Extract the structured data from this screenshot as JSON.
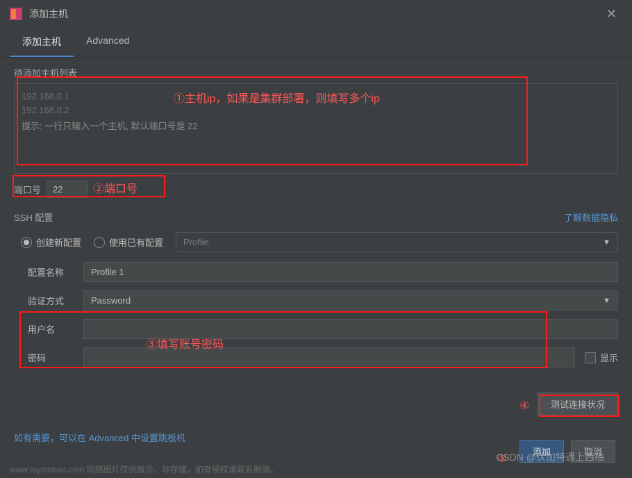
{
  "window": {
    "title": "添加主机"
  },
  "tabs": {
    "t1": "添加主机",
    "t2": "Advanced"
  },
  "hostlist": {
    "label": "待添加主机列表",
    "ip1": "192.168.0.1",
    "ip2": "192.168.0.2",
    "hint": "提示: 一行只输入一个主机, 默认端口号是 22"
  },
  "port": {
    "label": "端口号",
    "value": "22"
  },
  "ssh": {
    "title": "SSH 配置",
    "privacy_link": "了解数据隐私",
    "radio_new": "创建新配置",
    "radio_existing": "使用已有配置",
    "profile_placeholder": "Profile",
    "name_label": "配置名称",
    "name_value": "Profile 1",
    "auth_label": "验证方式",
    "auth_value": "Password",
    "user_label": "用户名",
    "user_value": "",
    "pass_label": "密码",
    "pass_value": "",
    "show_label": "显示"
  },
  "actions": {
    "test": "测试连接状况",
    "add": "添加",
    "cancel": "取消"
  },
  "advanced_note": "如有需要，可以在 Advanced 中设置跳板机",
  "annotations": {
    "a1": "①主机ip，如果是集群部署，则填写多个ip",
    "a2": "②端口号",
    "a3": "③填写账号密码",
    "a4": "④",
    "a5": "⑤"
  },
  "watermark": "CSDN @伏加特遇上西柚",
  "footer": "www.toymoban.com 网络图片仅供展示，非存储，如有侵权请联系删除。"
}
